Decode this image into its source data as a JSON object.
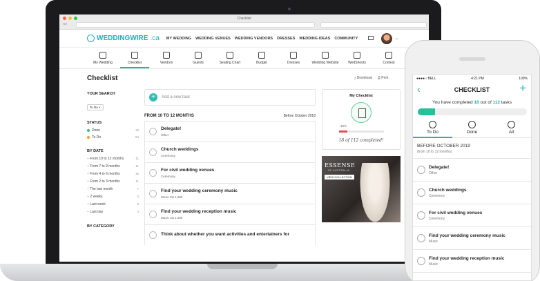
{
  "browser": {
    "tab_title": "Checklist",
    "nav_buttons": "◂ ▸"
  },
  "colors": {
    "accent": "#19b5bc",
    "progress_green": "#24c29a",
    "done_dot": "#2ec27e",
    "todo_dot": "#f0a030",
    "progress_red": "#e74c4c"
  },
  "header": {
    "logo_word": "WEDDINGWIRE",
    "logo_suffix": ".ca",
    "menu": [
      "MY WEDDING",
      "WEDDING VENUES",
      "WEDDING VENDORS",
      "DRESSES",
      "WEDDING IDEAS",
      "COMMUNITY"
    ],
    "caret": "⌄"
  },
  "toolbar": [
    {
      "label": "My Wedding",
      "icon": "rings-icon"
    },
    {
      "label": "Checklist",
      "icon": "clipboard-icon",
      "active": true
    },
    {
      "label": "Vendors",
      "icon": "book-icon"
    },
    {
      "label": "Guests",
      "icon": "people-icon"
    },
    {
      "label": "Seating Chart",
      "icon": "table-icon"
    },
    {
      "label": "Budget",
      "icon": "calculator-icon"
    },
    {
      "label": "Dresses",
      "icon": "dress-icon"
    },
    {
      "label": "Wedding Website",
      "icon": "website-icon"
    },
    {
      "label": "WedShoots",
      "icon": "photo-icon"
    },
    {
      "label": "Contest",
      "icon": "gift-icon"
    }
  ],
  "page": {
    "title": "Checklist",
    "download": "Download",
    "print": "Print"
  },
  "sidebar": {
    "search_heading": "YOUR SEARCH",
    "search_tag": "To Do",
    "status_heading": "STATUS",
    "status": [
      {
        "label": "Done",
        "count": "18"
      },
      {
        "label": "To Do",
        "count": "94"
      }
    ],
    "date_heading": "BY DATE",
    "dates": [
      {
        "label": "From 10 to 12 months",
        "count": "11"
      },
      {
        "label": "From 7 to 9 months",
        "count": "11"
      },
      {
        "label": "From 4 to 6 months",
        "count": "15"
      },
      {
        "label": "From 2 to 3 months",
        "count": "11"
      },
      {
        "label": "The last month",
        "count": "7"
      },
      {
        "label": "2 weeks",
        "count": "3"
      },
      {
        "label": "Last week",
        "count": "8"
      },
      {
        "label": "Last day",
        "count": "3"
      }
    ],
    "category_heading": "BY CATEGORY"
  },
  "tasks": {
    "add_placeholder": "Add a new task",
    "range_title": "FROM 10 TO 12 MONTHS",
    "range_date": "Before October 2018",
    "items": [
      {
        "title": "Delegate!",
        "sub": "Other"
      },
      {
        "title": "Church weddings",
        "sub": "Ceremony"
      },
      {
        "title": "For civil wedding venues",
        "sub": "Ceremony"
      },
      {
        "title": "Find your wedding ceremony music",
        "sub": "Music  C$ 1,280"
      },
      {
        "title": "Find your wedding reception music",
        "sub": "Music  C$ 1,280"
      },
      {
        "title": "Think about whether you want activities and entertainers for",
        "sub": ""
      }
    ]
  },
  "my_checklist": {
    "title": "My Checklist",
    "percent": "18%",
    "progress_fraction": 0.18,
    "completed_text": "18 of 112 completed!"
  },
  "ad": {
    "brand": "ESSENSE",
    "sub": "OF AUSTRALIA",
    "button": "VIEW COLLECTION"
  },
  "phone": {
    "carrier": "●●●●○ BELL",
    "time": "4:21 PM",
    "battery": "100%",
    "title": "CHECKLIST",
    "back": "‹",
    "plus": "+",
    "progress_pre": "You have completed",
    "progress_done": "18",
    "progress_mid": "out of",
    "progress_total": "112",
    "progress_post": "tasks",
    "progress_fraction": 0.16,
    "tabs": [
      {
        "label": "To Do",
        "active": true
      },
      {
        "label": "Done"
      },
      {
        "label": "All"
      }
    ],
    "section_title": "BEFORE OCTOBER 2019",
    "section_sub": "(from 10 to 12 months)",
    "items": [
      {
        "title": "Delegate!",
        "sub": "Other"
      },
      {
        "title": "Church weddings",
        "sub": "Ceremony"
      },
      {
        "title": "For civil wedding venues",
        "sub": "Ceremony"
      },
      {
        "title": "Find your wedding ceremony music",
        "sub": "Music"
      },
      {
        "title": "Find your wedding reception music",
        "sub": "Music"
      }
    ]
  }
}
